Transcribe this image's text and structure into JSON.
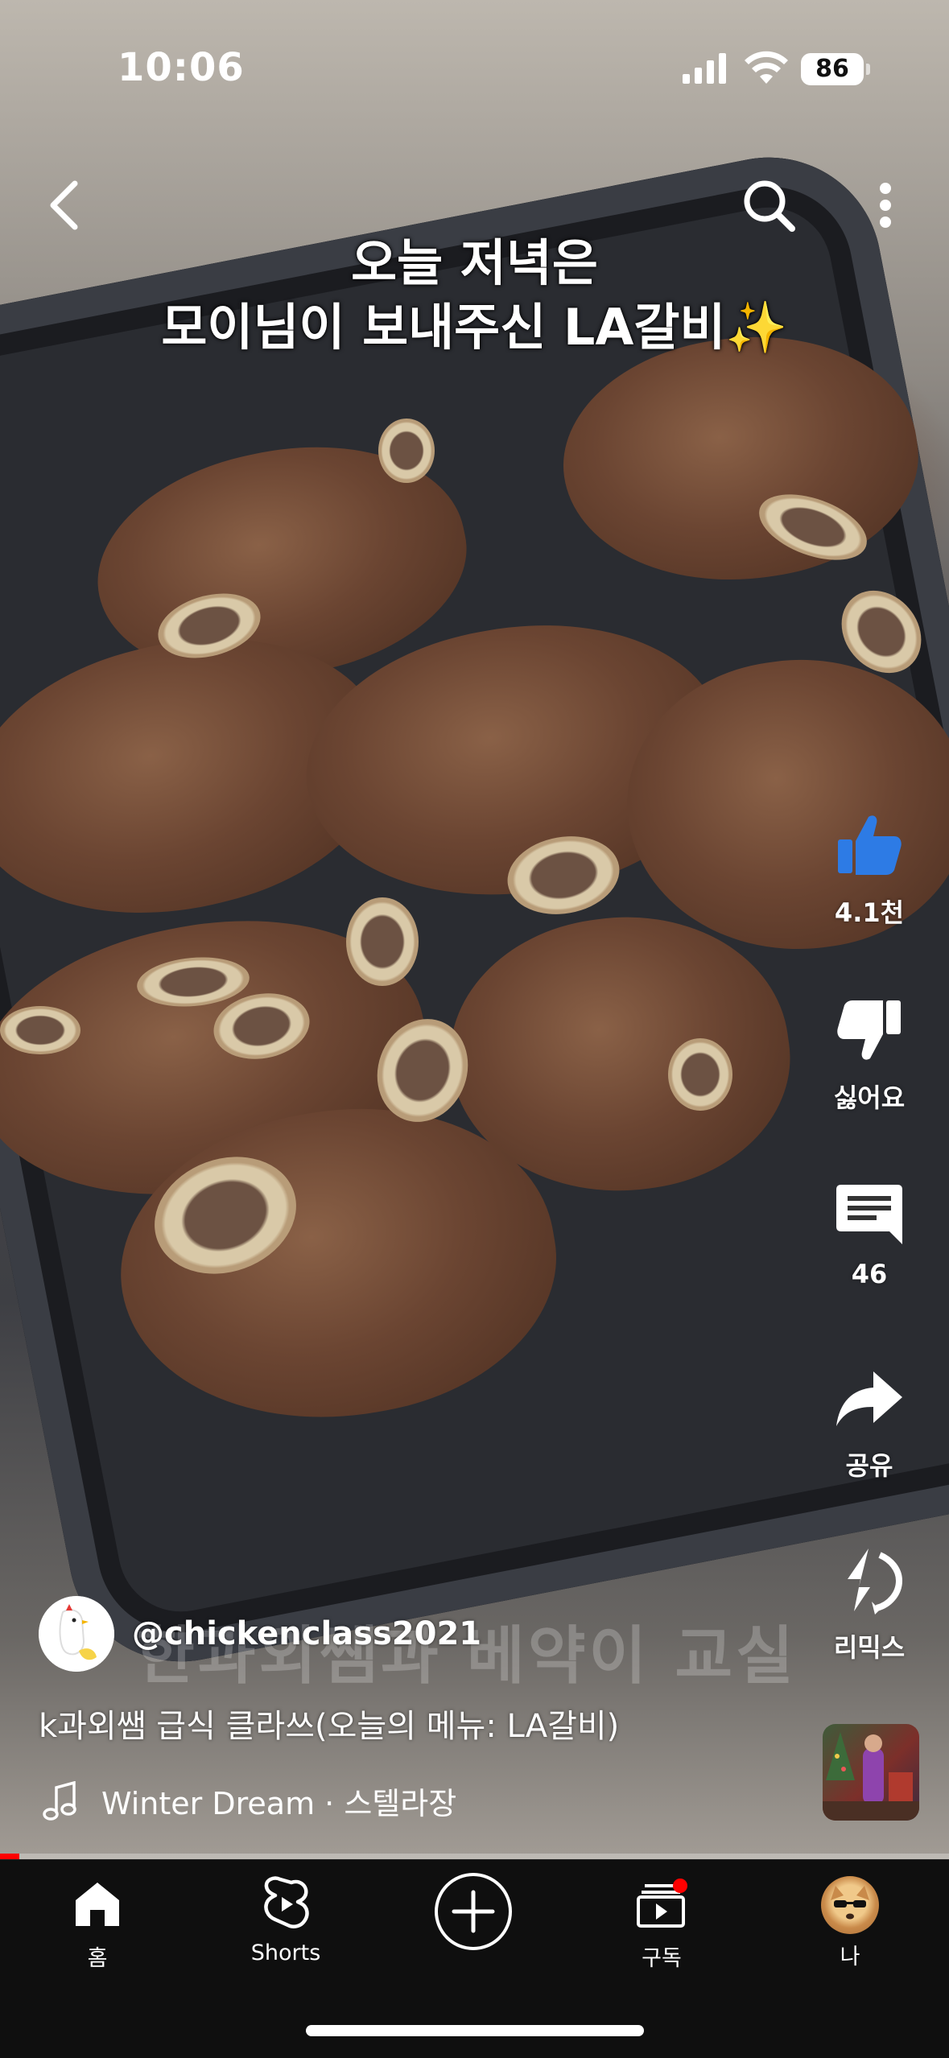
{
  "status_bar": {
    "time": "10:06",
    "battery": "86"
  },
  "video_caption": {
    "line1": "오늘 저녁은",
    "line2": "모이님이 보내주신 LA갈비✨"
  },
  "actions": {
    "like_count": "4.1천",
    "dislike_label": "싫어요",
    "comment_count": "46",
    "share_label": "공유",
    "remix_label": "리믹스"
  },
  "channel": {
    "handle": "@chickenclass2021",
    "watermark": "한과외쌤과 베약이 교실"
  },
  "video_title": "k과외쌤 급식 클라쓰(오늘의 메뉴: LA갈비)",
  "music": {
    "track": "Winter Dream · 스텔라장"
  },
  "progress": {
    "fraction": 0.02
  },
  "nav": {
    "home_label": "홈",
    "shorts_label": "Shorts",
    "subscriptions_label": "구독",
    "me_label": "나"
  },
  "colors": {
    "accent": "#ff0000",
    "nav_bg": "#0f0f0f",
    "like_blue": "#2d7be5"
  }
}
